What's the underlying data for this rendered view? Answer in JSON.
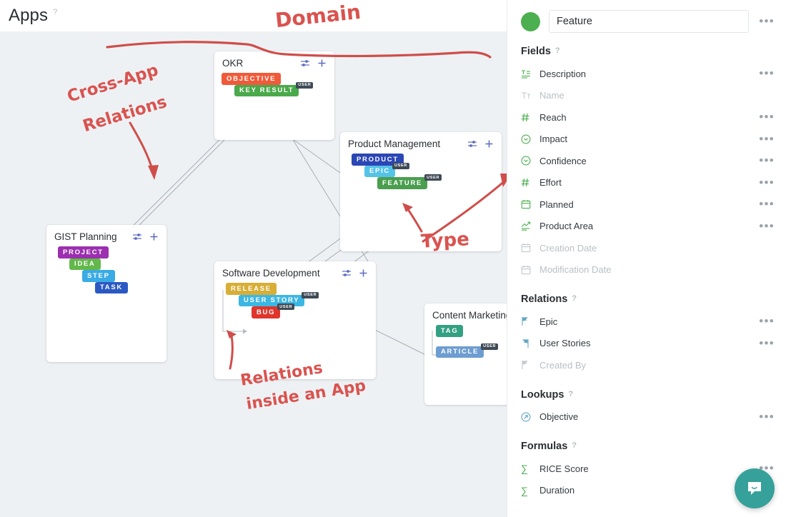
{
  "left": {
    "header_title": "Apps",
    "header_help": "?",
    "cards": [
      {
        "id": "okr",
        "title": "OKR",
        "settings_icon": "sliders-icon",
        "add_icon": "plus-icon",
        "entities": [
          {
            "label": "OBJECTIVE",
            "color": "#ef5a3a",
            "user": false,
            "indent": 0
          },
          {
            "label": "KEY RESULT",
            "color": "#4aa94a",
            "user": true,
            "user_label": "USER",
            "indent": 18
          }
        ]
      },
      {
        "id": "product-management",
        "title": "Product Management",
        "settings_icon": "sliders-icon",
        "add_icon": "plus-icon",
        "entities": [
          {
            "label": "PRODUCT",
            "color": "#2b46b5",
            "user": false,
            "indent": 0
          },
          {
            "label": "EPIC",
            "color": "#55c3e8",
            "user": true,
            "user_label": "USER",
            "indent": 18
          },
          {
            "label": "FEATURE",
            "color": "#4a9e4e",
            "user": true,
            "user_label": "USER",
            "indent": 36
          }
        ]
      },
      {
        "id": "gist-planning",
        "title": "GIST Planning",
        "settings_icon": "sliders-icon",
        "add_icon": "plus-icon",
        "entities": [
          {
            "label": "PROJECT",
            "color": "#9b2fb0",
            "user": false,
            "indent": 0
          },
          {
            "label": "IDEA",
            "color": "#63b84b",
            "user": false,
            "indent": 18
          },
          {
            "label": "STEP",
            "color": "#3aabe4",
            "user": false,
            "indent": 36
          },
          {
            "label": "TASK",
            "color": "#2b59c4",
            "user": false,
            "indent": 54
          }
        ]
      },
      {
        "id": "software-development",
        "title": "Software Development",
        "settings_icon": "sliders-icon",
        "add_icon": "plus-icon",
        "entities": [
          {
            "label": "RELEASE",
            "color": "#d7ae36",
            "user": false,
            "indent": 0
          },
          {
            "label": "USER STORY",
            "color": "#3cb6e3",
            "user": true,
            "user_label": "USER",
            "indent": 18
          },
          {
            "label": "BUG",
            "color": "#e0352b",
            "user": true,
            "user_label": "USER",
            "indent": 36
          }
        ]
      },
      {
        "id": "content-marketing",
        "title": "Content Marketing",
        "settings_icon": "sliders-icon",
        "add_icon": "plus-icon",
        "entities": [
          {
            "label": "TAG",
            "color": "#33a083",
            "user": false,
            "indent": 0
          },
          {
            "label": "ARTICLE",
            "color": "#6d9dd1",
            "user": true,
            "user_label": "USER",
            "indent": 0
          }
        ]
      }
    ],
    "annotations": [
      {
        "id": "domain",
        "text": "Domain"
      },
      {
        "id": "cross-app-relations",
        "text": "Cross-App"
      },
      {
        "id": "cross-app-relations2",
        "text": "Relations"
      },
      {
        "id": "type",
        "text": "Type"
      },
      {
        "id": "relations-inside-app",
        "text": "Relations"
      },
      {
        "id": "relations-inside-app2",
        "text": "inside an App"
      }
    ],
    "annotation_color": "#d9534f"
  },
  "panel": {
    "entity_color": "#4caf50",
    "entity_name": "Feature",
    "more_menu": "•••",
    "help": "?",
    "sections": [
      {
        "id": "fields",
        "title": "Fields",
        "help": "?",
        "rows": [
          {
            "label": "Description",
            "icon": "text-field-icon",
            "dim": false
          },
          {
            "label": "Name",
            "icon": "title-field-icon",
            "dim": true
          },
          {
            "label": "Reach",
            "icon": "number-field-icon",
            "dim": false
          },
          {
            "label": "Impact",
            "icon": "select-field-icon",
            "dim": false
          },
          {
            "label": "Confidence",
            "icon": "select-field-icon",
            "dim": false
          },
          {
            "label": "Effort",
            "icon": "number-field-icon",
            "dim": false
          },
          {
            "label": "Planned",
            "icon": "date-field-icon",
            "dim": false
          },
          {
            "label": "Product Area",
            "icon": "chart-field-icon",
            "dim": false
          },
          {
            "label": "Creation Date",
            "icon": "date-field-icon",
            "dim": true
          },
          {
            "label": "Modification Date",
            "icon": "date-field-icon",
            "dim": true
          }
        ]
      },
      {
        "id": "relations",
        "title": "Relations",
        "help": "?",
        "rows": [
          {
            "label": "Epic",
            "icon": "relation-flag-icon",
            "dim": false
          },
          {
            "label": "User Stories",
            "icon": "relation-arrow-icon",
            "dim": false
          },
          {
            "label": "Created By",
            "icon": "relation-flag-icon",
            "dim": true
          }
        ]
      },
      {
        "id": "lookups",
        "title": "Lookups",
        "help": "?",
        "rows": [
          {
            "label": "Objective",
            "icon": "lookup-arrow-icon",
            "dim": false
          }
        ]
      },
      {
        "id": "formulas",
        "title": "Formulas",
        "help": "?",
        "rows": [
          {
            "label": "RICE Score",
            "icon": "sigma-icon",
            "dim": false
          },
          {
            "label": "Duration",
            "icon": "sigma-icon",
            "dim": false
          }
        ]
      }
    ]
  },
  "chat": {
    "icon": "chat-bubble-icon",
    "color": "#35a19a"
  }
}
